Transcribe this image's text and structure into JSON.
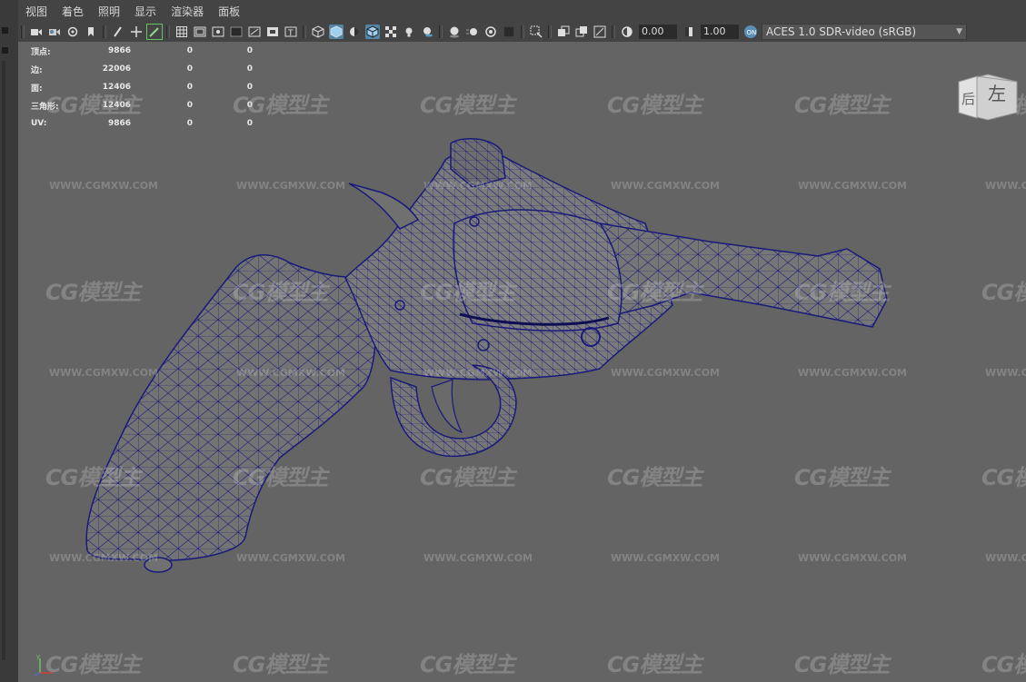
{
  "menubar": {
    "items": [
      "视图",
      "着色",
      "照明",
      "显示",
      "渲染器",
      "面板"
    ]
  },
  "toolbar": {
    "exposure_value": "0.00",
    "gamma_value": "1.00",
    "color_space": "ACES 1.0 SDR-video (sRGB)",
    "icons": [
      "camera-select-icon",
      "camera-attributes-icon",
      "bookmark-icon",
      "image-plane-icon",
      "grease-pencil-icon",
      "2d-pan-zoom-icon",
      "grid-icon",
      "film-gate-icon",
      "resolution-gate-icon",
      "gate-mask-icon",
      "field-chart-icon",
      "safe-action-icon",
      "safe-title-icon",
      "wireframe-icon",
      "smooth-shade-icon",
      "default-material-icon",
      "wireframe-on-shaded-icon",
      "textured-icon",
      "use-all-lights-icon",
      "shadows-icon",
      "screen-space-ao-icon",
      "motion-blur-icon",
      "anti-aliasing-icon",
      "depth-of-field-icon",
      "isolate-select-icon",
      "xray-icon",
      "xray-joints-icon",
      "backface-culling-icon",
      "exposure-icon",
      "gamma-icon",
      "color-management-icon"
    ]
  },
  "hud": {
    "rows": [
      {
        "label": "顶点:",
        "v1": "9866",
        "v2": "0",
        "v3": "0"
      },
      {
        "label": "边:",
        "v1": "22006",
        "v2": "0",
        "v3": "0"
      },
      {
        "label": "面:",
        "v1": "12406",
        "v2": "0",
        "v3": "0"
      },
      {
        "label": "三角形:",
        "v1": "12406",
        "v2": "0",
        "v3": "0"
      },
      {
        "label": "UV:",
        "v1": "9866",
        "v2": "0",
        "v3": "0"
      }
    ]
  },
  "viewcube": {
    "face_back": "后",
    "face_left": "左"
  },
  "watermark": {
    "logo": "CG模型主",
    "url": "WWW.CGMXW.COM"
  },
  "colors": {
    "wireframe": "#1a1a7a",
    "viewport_bg": "#646464",
    "highlight": "#5285a6"
  }
}
